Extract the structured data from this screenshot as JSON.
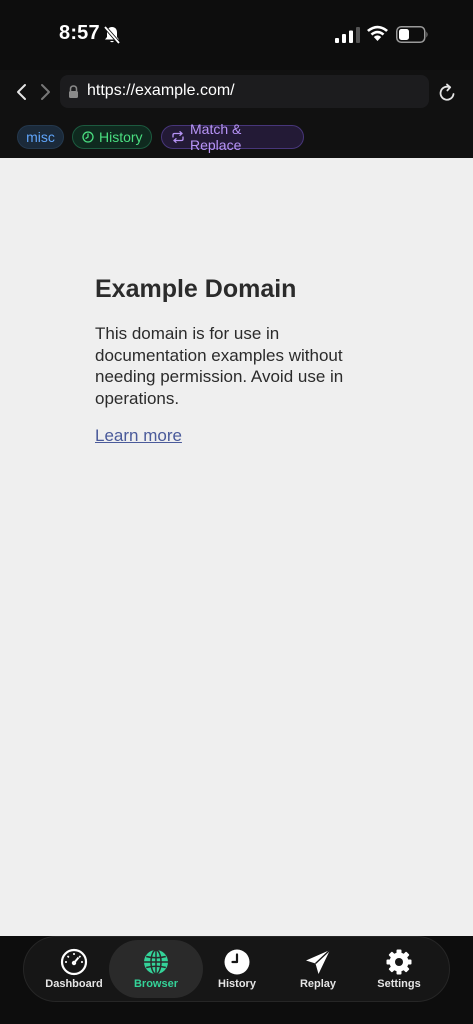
{
  "status_bar": {
    "time": "8:57"
  },
  "browser": {
    "url": "https://example.com/"
  },
  "chips": [
    {
      "label": "misc",
      "color": "#60a5fa"
    },
    {
      "label": "History",
      "color": "#4ade80"
    },
    {
      "label": "Match & Replace",
      "color": "#b794f6"
    }
  ],
  "page": {
    "heading": "Example Domain",
    "description": "This domain is for use in documentation examples without needing permission. Avoid use in operations.",
    "link_text": "Learn more"
  },
  "tabs": [
    {
      "label": "Dashboard",
      "icon": "speedometer-icon",
      "active": false
    },
    {
      "label": "Browser",
      "icon": "globe-icon",
      "active": true
    },
    {
      "label": "History",
      "icon": "clock-icon",
      "active": false
    },
    {
      "label": "Replay",
      "icon": "paper-plane-icon",
      "active": false
    },
    {
      "label": "Settings",
      "icon": "gear-icon",
      "active": false
    }
  ],
  "colors": {
    "active_tab": "#34d399",
    "content_bg": "#efefef"
  }
}
